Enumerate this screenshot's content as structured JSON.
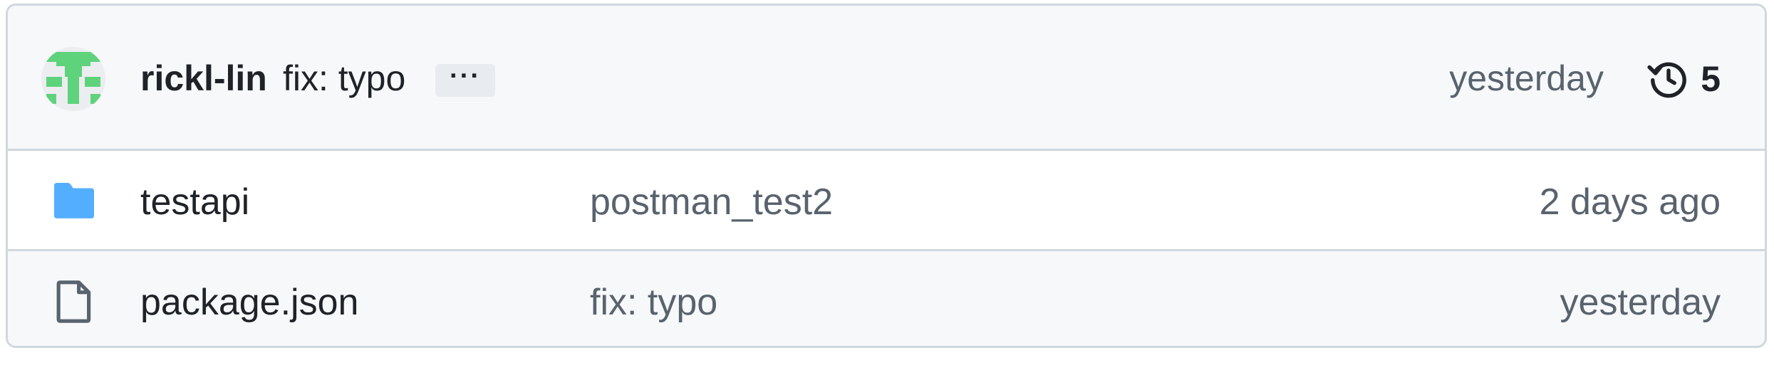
{
  "latest_commit": {
    "author": "rickl-lin",
    "message": "fix: typo",
    "more_label": "···",
    "time": "yesterday",
    "history_icon": "history-icon",
    "commit_count": "5"
  },
  "files": [
    {
      "type": "folder",
      "icon": "folder-icon",
      "icon_color": "#54aeff",
      "name": "testapi",
      "last_commit": "postman_test2",
      "time": "2 days ago"
    },
    {
      "type": "file",
      "icon": "file-icon",
      "icon_color": "#59636e",
      "name": "package.json",
      "last_commit": "fix: typo",
      "time": "yesterday"
    }
  ],
  "colors": {
    "avatar_green": "#5ed37b",
    "border": "#d0d7de",
    "muted_text": "#59636e"
  }
}
